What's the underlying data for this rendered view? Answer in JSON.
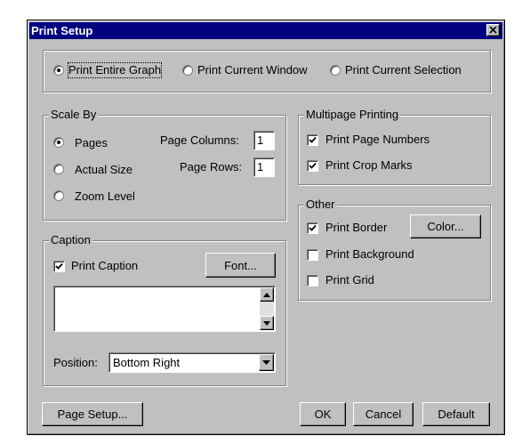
{
  "title": "Print Setup",
  "print_mode": {
    "options": [
      "Print Entire Graph",
      "Print Current Window",
      "Print Current Selection"
    ],
    "selected": "Print Entire Graph"
  },
  "scale_by": {
    "label": "Scale By",
    "options": [
      "Pages",
      "Actual Size",
      "Zoom Level"
    ],
    "selected": "Pages",
    "page_columns_label": "Page Columns:",
    "page_columns_value": "1",
    "page_rows_label": "Page Rows:",
    "page_rows_value": "1"
  },
  "multipage": {
    "label": "Multipage Printing",
    "print_page_numbers_label": "Print Page Numbers",
    "print_page_numbers_checked": true,
    "print_crop_marks_label": "Print Crop Marks",
    "print_crop_marks_checked": true
  },
  "caption": {
    "label": "Caption",
    "print_caption_label": "Print Caption",
    "print_caption_checked": true,
    "font_button": "Font...",
    "text_value": "",
    "position_label": "Position:",
    "position_value": "Bottom Right"
  },
  "other": {
    "label": "Other",
    "print_border_label": "Print Border",
    "print_border_checked": true,
    "color_button": "Color...",
    "print_background_label": "Print Background",
    "print_background_checked": false,
    "print_grid_label": "Print Grid",
    "print_grid_checked": false
  },
  "buttons": {
    "page_setup": "Page Setup...",
    "ok": "OK",
    "cancel": "Cancel",
    "default": "Default"
  }
}
